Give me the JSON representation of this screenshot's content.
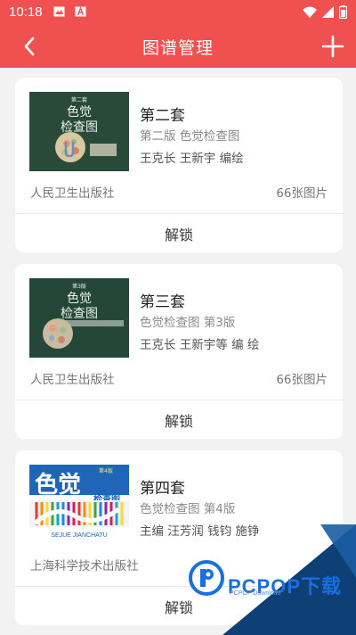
{
  "status_bar": {
    "time": "10:18",
    "icons": [
      "image-icon",
      "font-icon",
      "wifi-icon",
      "signal-icon",
      "battery-icon"
    ]
  },
  "app_bar": {
    "title": "图谱管理",
    "back_icon": "back-arrow-icon",
    "add_icon": "plus-icon",
    "color": "#f0504f"
  },
  "cards": [
    {
      "cover": {
        "top": "第二套",
        "title1": "色觉",
        "title2": "检查图",
        "bg": "#2a4a39"
      },
      "name": "第二套",
      "edition": "第二版 色觉检查图",
      "authors": "王克长 王新宇 编绘",
      "publisher": "人民卫生出版社",
      "count": "66张图片",
      "action": "解锁"
    },
    {
      "cover": {
        "top": "第3版",
        "title1": "色觉",
        "title2": "检查图",
        "bg": "#24473a"
      },
      "name": "第三套",
      "edition": "色觉检查图 第3版",
      "authors": "王克长 王新宇等 编 绘",
      "publisher": "人民卫生出版社",
      "count": "66张图片",
      "action": "解锁"
    },
    {
      "cover": {
        "top": "第4版",
        "title1": "色觉",
        "title2": "检查图",
        "sub": "SEJUE JIANCHATU"
      },
      "name": "第四套",
      "edition": "色觉检查图 第4版",
      "authors": "主编 汪芳润 钱钧 施铮",
      "publisher": "上海科学技术出版社",
      "count": "",
      "action": "解锁"
    }
  ],
  "watermark": {
    "brand": "PCPOP下载",
    "sub": "PCPOP Download"
  }
}
